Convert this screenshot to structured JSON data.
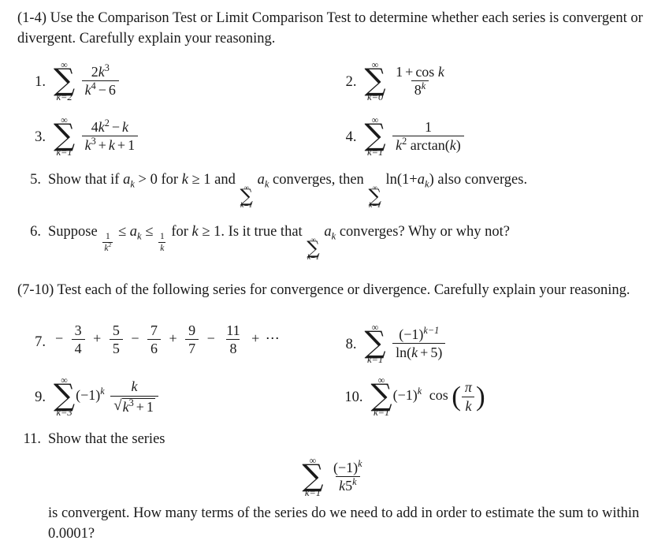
{
  "document": {
    "instructions_1_4": "(1-4) Use the Comparison Test or Limit Comparison Test to determine whether each series is convergent or divergent. Carefully explain your reasoning.",
    "instructions_7_10": "(7-10) Test each of the following series for convergence or divergence. Carefully explain your reasoning."
  },
  "problems": {
    "p1": {
      "number": "1.",
      "sum_top": "∞",
      "sum_bottom": "k=2",
      "numerator_coeff": "2",
      "numerator_var": "k",
      "numerator_exp": "3",
      "den_var": "k",
      "den_exp": "4",
      "den_op": "−",
      "den_const": "6"
    },
    "p2": {
      "number": "2.",
      "sum_top": "∞",
      "sum_bottom": "k=0",
      "num_one": "1",
      "num_op": "+",
      "num_fn": "cos",
      "num_var": "k",
      "den_base": "8",
      "den_exp": "k"
    },
    "p3": {
      "number": "3.",
      "sum_top": "∞",
      "sum_bottom": "k=1",
      "num_coeff": "4",
      "num_var": "k",
      "num_exp": "2",
      "num_op": "−",
      "num_var2": "k",
      "den_var": "k",
      "den_exp": "3",
      "den_op1": "+",
      "den_var2": "k",
      "den_op2": "+",
      "den_const": "1"
    },
    "p4": {
      "number": "4.",
      "sum_top": "∞",
      "sum_bottom": "k=1",
      "num": "1",
      "den_var": "k",
      "den_exp": "2",
      "den_fn": "arctan",
      "den_arg": "k"
    },
    "p5": {
      "number": "5.",
      "text_a": "Show that if",
      "var_a": "a",
      "var_a_sub": "k",
      "text_b": "> 0 for",
      "var_k": "k",
      "text_c": "≥ 1 and",
      "sum_top": "∞",
      "sum_bottom": "k=1",
      "term": "a",
      "term_sub": "k",
      "text_d": "converges, then",
      "sum2_top": "∞",
      "sum2_bottom": "k=1",
      "fn": "ln(1",
      "fn_op": "+",
      "fn_var": "a",
      "fn_var_sub": "k",
      "fn_close": ")",
      "text_e": "also converges."
    },
    "p6": {
      "number": "6.",
      "text_a": "Suppose",
      "frac1_num": "1",
      "frac1_den_var": "k",
      "frac1_den_exp": "2",
      "rel1": "≤",
      "var_a": "a",
      "var_a_sub": "k",
      "rel2": "≤",
      "frac2_num": "1",
      "frac2_den": "k",
      "text_b": "for",
      "var_k": "k",
      "text_c": "≥ 1. Is it true that",
      "sum_top": "∞",
      "sum_bottom": "k=1",
      "term": "a",
      "term_sub": "k",
      "text_d": "converges? Why or why not?"
    },
    "p7": {
      "number": "7.",
      "terms": [
        {
          "sign": "−",
          "num": "3",
          "den": "4"
        },
        {
          "sign": "+",
          "num": "5",
          "den": "5"
        },
        {
          "sign": "−",
          "num": "7",
          "den": "6"
        },
        {
          "sign": "+",
          "num": "9",
          "den": "7"
        },
        {
          "sign": "−",
          "num": "11",
          "den": "8"
        }
      ],
      "tail_op": "+",
      "tail": "⋯"
    },
    "p8": {
      "number": "8.",
      "sum_top": "∞",
      "sum_bottom": "k=1",
      "num_base": "(−1)",
      "num_exp": "k−1",
      "den_fn": "ln(",
      "den_var": "k",
      "den_op": "+",
      "den_const": "5",
      "den_close": ")"
    },
    "p9": {
      "number": "9.",
      "sum_top": "∞",
      "sum_bottom": "k=3",
      "factor_base": "(−1)",
      "factor_exp": "k",
      "num_var": "k",
      "radical": "√",
      "den_var": "k",
      "den_exp": "3",
      "den_op": "+",
      "den_const": "1"
    },
    "p10": {
      "number": "10.",
      "sum_top": "∞",
      "sum_bottom": "k=1",
      "factor_base": "(−1)",
      "factor_exp": "k",
      "fn": "cos",
      "arg_num": "π",
      "arg_den": "k"
    },
    "p11": {
      "number": "11.",
      "lead_text": "Show that the series",
      "sum_top": "∞",
      "sum_bottom": "k=1",
      "num_base": "(−1)",
      "num_exp": "k",
      "den_var": "k",
      "den_base": "5",
      "den_exp": "k",
      "trail_text": "is convergent. How many terms of the series do we need to add in order to estimate the sum to within 0.0001?"
    }
  }
}
